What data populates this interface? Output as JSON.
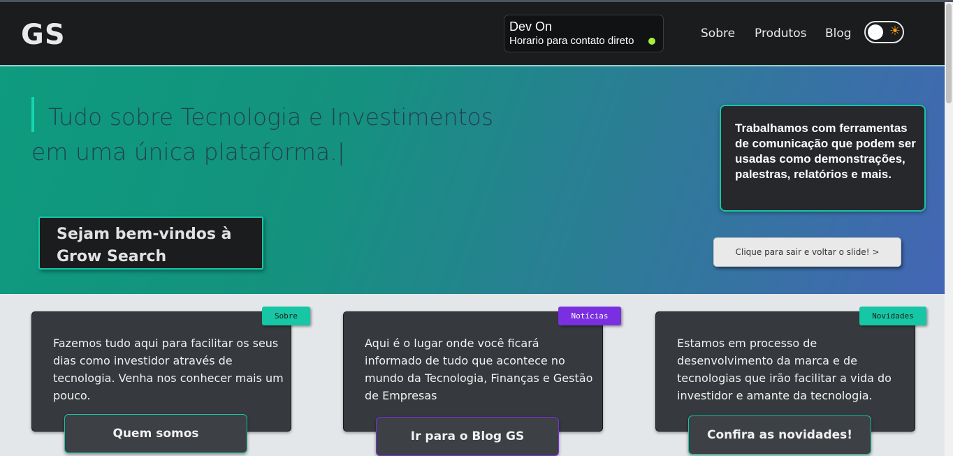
{
  "navbar": {
    "logo": "GS",
    "dev_status": {
      "title": "Dev On",
      "subtitle": "Horario para contato direto",
      "indicator_color": "#a6ee3f"
    },
    "links": [
      "Sobre",
      "Produtos",
      "Blog"
    ],
    "theme_toggle": {
      "icon": "sun-icon",
      "state": "off"
    }
  },
  "hero": {
    "title": "Tudo sobre Tecnologia e Investimentos em uma única plataforma.|",
    "welcome": "Sejam bem-vindos à Grow Search",
    "info": "Trabalhamos com ferramentas de comunicação que podem ser usadas como demonstrações, palestras, relatórios e mais.",
    "slide_button": "Clique para sair e voltar o slide!   >"
  },
  "cards": [
    {
      "tag": "Sobre",
      "tag_color": "#16c6a4",
      "text": "Fazemos tudo aqui para facilitar os seus dias como investidor através de tecnologia. Venha nos conhecer mais um pouco.",
      "button": "Quem somos",
      "button_border": "#16c6a4"
    },
    {
      "tag": "Notícias",
      "tag_color": "#7a2fe0",
      "text": "Aqui é o lugar onde você ficará informado de tudo que acontece no mundo da Tecnologia, Finanças e Gestão de Empresas",
      "button": "Ir para o Blog GS",
      "button_border": "#7a2fe0"
    },
    {
      "tag": "Novidades",
      "tag_color": "#16c6a4",
      "text": "Estamos em processo de desenvolvimento da marca e de tecnologias que irão facilitar a vida do investidor e amante da tecnologia.",
      "button": "Confira as novidades!",
      "button_border": "#16c6a4"
    }
  ],
  "colors": {
    "accent": "#16c6a4",
    "navbar_bg": "#1b1c1e",
    "card_bg": "#36393d"
  }
}
